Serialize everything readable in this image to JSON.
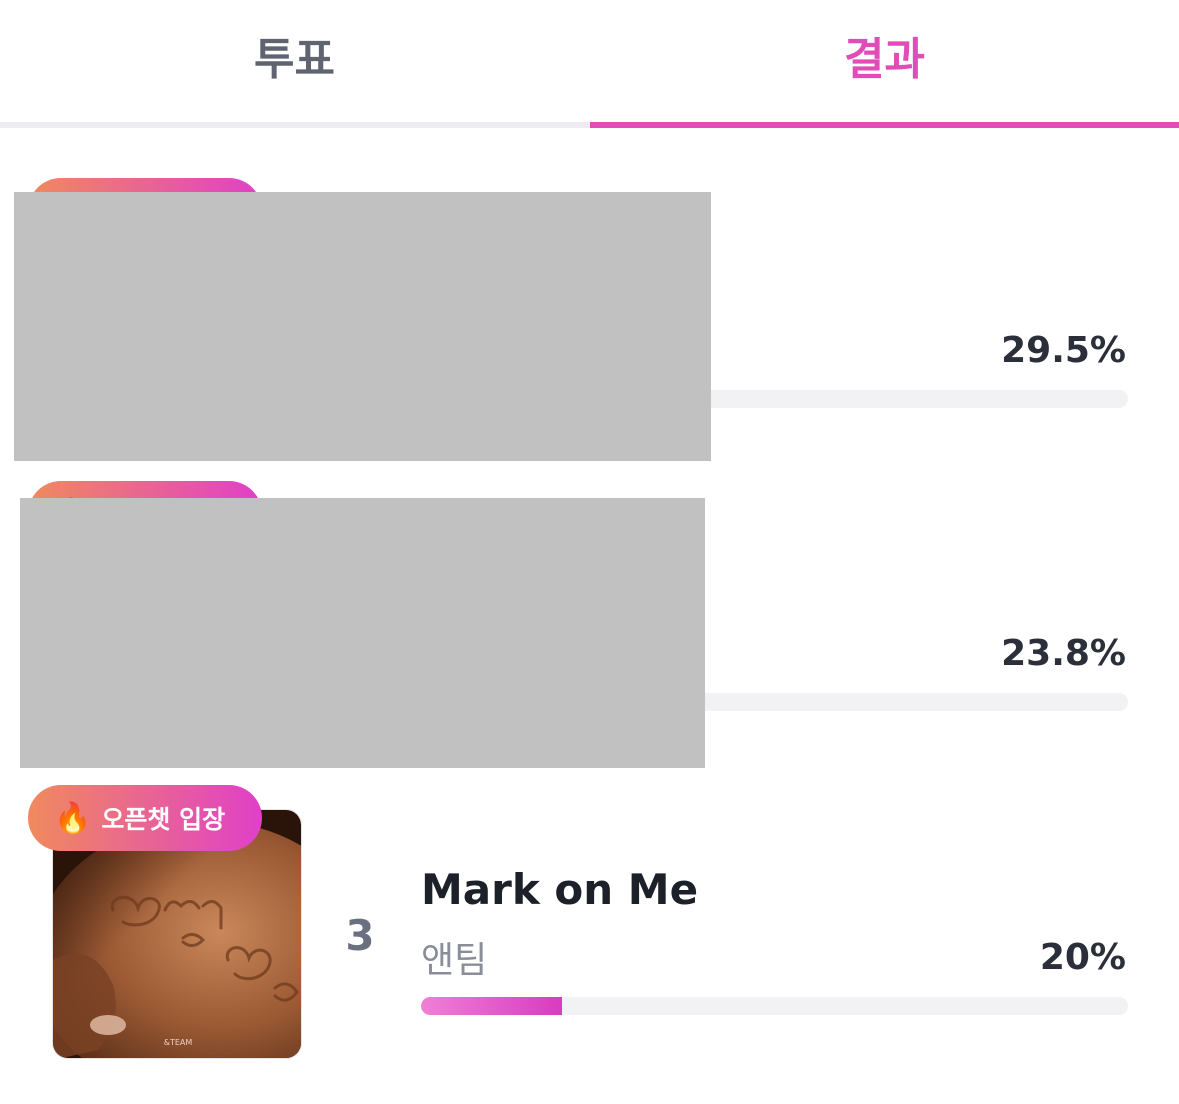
{
  "tabs": {
    "vote_label": "투표",
    "result_label": "결과",
    "active": "result",
    "active_color": "#e04db8"
  },
  "badge": {
    "label": "오픈챗 입장",
    "icon": "fire-icon",
    "icon_glyph": "🔥",
    "gradient_start": "#f08a5d",
    "gradient_end": "#e040c8"
  },
  "progress_fill_start": "#f07fd6",
  "progress_fill_end": "#d93bc0",
  "entries": [
    {
      "percent_label": "29.5%",
      "percent": 29.5,
      "redacted": true
    },
    {
      "percent_label": "23.8%",
      "percent": 23.8,
      "redacted": true
    },
    {
      "rank": "3",
      "title": "Mark on Me",
      "artist": "앤팀",
      "percent_label": "20%",
      "percent": 20,
      "album_art_text": "&TEAM",
      "redacted": false
    }
  ]
}
